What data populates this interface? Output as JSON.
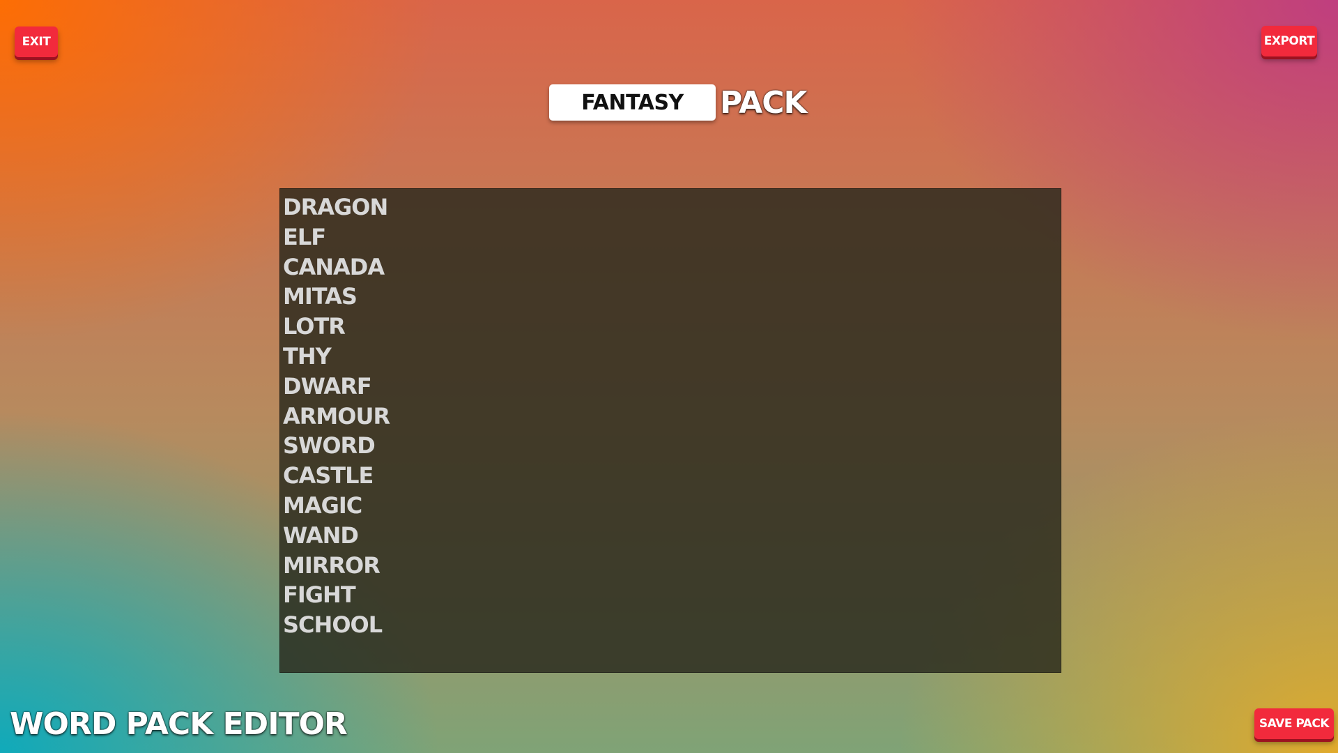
{
  "toolbar": {
    "exit_label": "EXIT",
    "export_label": "EXPORT",
    "save_label": "SAVE PACK"
  },
  "header": {
    "pack_name_value": "FANTASY",
    "pack_suffix": "PACK"
  },
  "word_list": {
    "words": [
      "DRAGON",
      "ELF",
      "CANADA",
      "MITAS",
      "LOTR",
      "THY",
      "DWARF",
      "ARMOUR",
      "SWORD",
      "CASTLE",
      "MAGIC",
      "WAND",
      "MIRROR",
      "FIGHT",
      "SCHOOL"
    ]
  },
  "footer": {
    "app_title": "WORD PACK EDITOR"
  },
  "colors": {
    "button_red": "#f22a3c",
    "panel_bg": "#28281c",
    "word_text": "#d8d8d8"
  }
}
